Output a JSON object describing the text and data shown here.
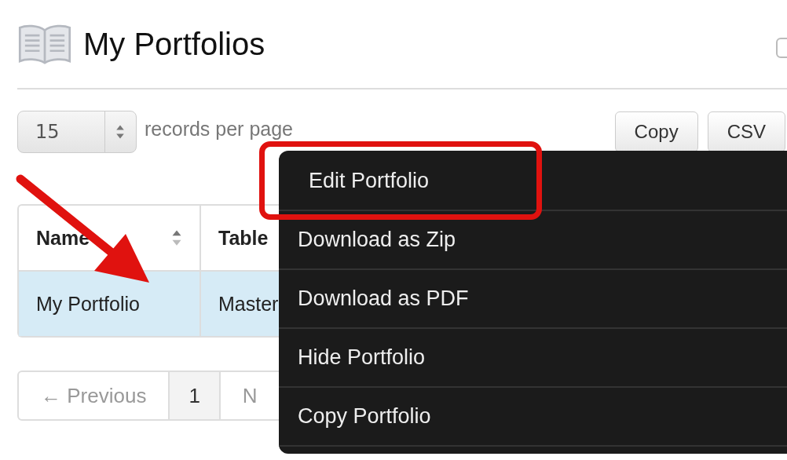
{
  "page": {
    "title": "My Portfolios",
    "checkbox": {
      "checked": false
    }
  },
  "length_menu": {
    "value": "15",
    "label": "records per page"
  },
  "export_buttons": [
    "Copy",
    "CSV"
  ],
  "table": {
    "columns": [
      {
        "label": "Name",
        "sortable": true
      },
      {
        "label": "Table",
        "sortable": false
      }
    ],
    "rows": [
      {
        "cells": [
          "My Portfolio",
          "Master"
        ],
        "selected": true
      }
    ]
  },
  "pagination": {
    "previous": {
      "label": "← Previous",
      "disabled": true
    },
    "pages": [
      {
        "label": "1",
        "selected": true
      }
    ],
    "next": {
      "label": "N",
      "disabled": true
    }
  },
  "context_menu": {
    "items": [
      {
        "label": "Edit Portfolio",
        "annotated": true
      },
      {
        "label": "Download as Zip",
        "annotated": false
      },
      {
        "label": "Download as PDF",
        "annotated": false
      },
      {
        "label": "Hide Portfolio",
        "annotated": false
      },
      {
        "label": "Copy Portfolio",
        "annotated": false
      }
    ]
  },
  "annotations": {
    "arrow": true
  }
}
